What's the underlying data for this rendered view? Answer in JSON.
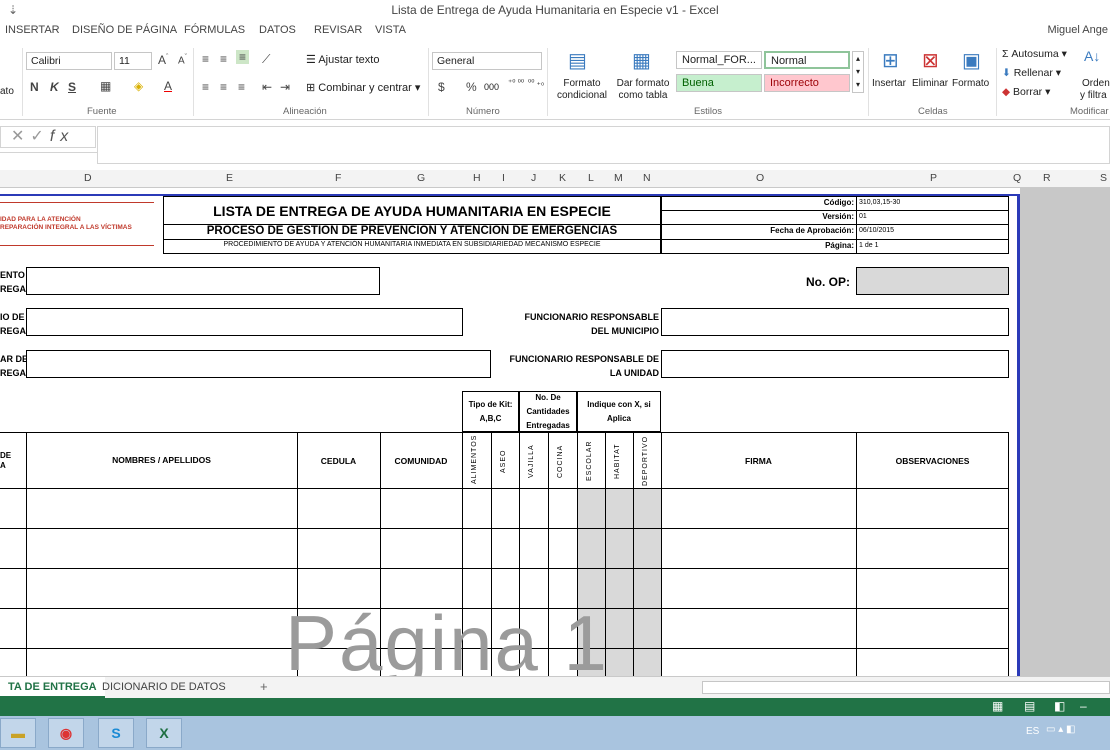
{
  "window": {
    "title": "Lista de Entrega de Ayuda Humanitaria en Especie v1 - Excel",
    "user": "Miguel Ange",
    "quick_access": "⇣"
  },
  "ribbon_tabs": [
    "INSERTAR",
    "DISEÑO DE PÁGINA",
    "FÓRMULAS",
    "DATOS",
    "REVISAR",
    "VISTA"
  ],
  "ribbon": {
    "left_cut": "ato",
    "font": {
      "name": "Calibri",
      "size": "11",
      "bold": "N",
      "italic": "K",
      "underline": "S",
      "group": "Fuente"
    },
    "alignment": {
      "wrap": "Ajustar texto",
      "merge": "Combinar y centrar",
      "group": "Alineación"
    },
    "number": {
      "format": "General",
      "currency": "$",
      "percent": "%",
      "thousands": "000",
      "inc_dec": "⁺⁰ ⁰⁰",
      "dec_dec": "⁰⁰ ₊₀",
      "group": "Número"
    },
    "styles": {
      "cond_format": "Formato condicional",
      "table_format": "Dar formato como tabla",
      "cells": [
        {
          "label": "Normal_FOR...",
          "bg": "#ffffff"
        },
        {
          "label": "Normal",
          "bg": "#ffffff"
        },
        {
          "label": "Buena",
          "bg": "#c6efce",
          "fg": "#006100"
        },
        {
          "label": "Incorrecto",
          "bg": "#ffc7ce",
          "fg": "#9c0006"
        }
      ],
      "group": "Estilos"
    },
    "cells": {
      "insert": "Insertar",
      "delete": "Eliminar",
      "format": "Formato",
      "group": "Celdas"
    },
    "editing": {
      "autosum": "Autosuma",
      "fill": "Rellenar",
      "clear": "Borrar",
      "sort": "Orden",
      "filter": "y filtra",
      "group": "Modificar"
    }
  },
  "formula_bar": {
    "fx": "fx",
    "cancel": "✕",
    "enter": "✓"
  },
  "columns": [
    "D",
    "E",
    "F",
    "G",
    "H",
    "I",
    "J",
    "K",
    "L",
    "M",
    "N",
    "O",
    "P",
    "Q",
    "R",
    "S"
  ],
  "form": {
    "org_line1": "IDAD PARA LA ATENCIÓN",
    "org_line2": "REPARACIÓN INTEGRAL A LAS VÍCTIMAS",
    "title": "LISTA DE ENTREGA DE AYUDA HUMANITARIA EN ESPECIE",
    "process": "PROCESO DE GESTION DE PREVENCION Y ATENCION DE EMERGENCIAS",
    "procedure": "PROCEDIMIENTO DE AYUDA Y ATENCIÓN HUMANITARIA INMEDIATA EN SUBSIDIARIEDAD MECANISMO ESPECIE",
    "meta": [
      {
        "label": "Código:",
        "value": "310,03,15-30"
      },
      {
        "label": "Versión:",
        "value": "01"
      },
      {
        "label": "Fecha de Aprobación:",
        "value": "06/10/2015"
      },
      {
        "label": "Página:",
        "value": "1 de 1"
      }
    ],
    "field1": [
      "ENTO",
      "REGA:"
    ],
    "field2": [
      "IO DE",
      "REGA:"
    ],
    "field3": [
      "AR DE",
      "REGA:"
    ],
    "op_label": "No. OP:",
    "func_mun": [
      "FUNCIONARIO RESPONSABLE",
      "DEL MUNICIPIO"
    ],
    "func_uni": [
      "FUNCIONARIO RESPONSABLE DE",
      "LA UNIDAD"
    ],
    "kit_type": [
      "Tipo de Kit:",
      "A,B,C"
    ],
    "qty": [
      "No. De",
      "Cantidades",
      "Entregadas"
    ],
    "indicate": [
      "Indique con X, si",
      "Aplica"
    ],
    "col_first": [
      "DE",
      "A"
    ],
    "col_names": "NOMBRES / APELLIDOS",
    "col_cedula": "CEDULA",
    "col_comunidad": "COMUNIDAD",
    "vert": [
      "ALIMENTOS",
      "ASEO",
      "VAJILLA",
      "COCINA",
      "ESCOLAR",
      "HABITAT",
      "DEPORTIVO"
    ],
    "col_firma": "FIRMA",
    "col_obs": "OBSERVACIONES",
    "watermark": "Página 1"
  },
  "sheet_tabs": [
    "TA DE ENTREGA",
    "DICIONARIO DE DATOS"
  ],
  "add_sheet": "+",
  "taskbar": {
    "lang": "ES"
  }
}
